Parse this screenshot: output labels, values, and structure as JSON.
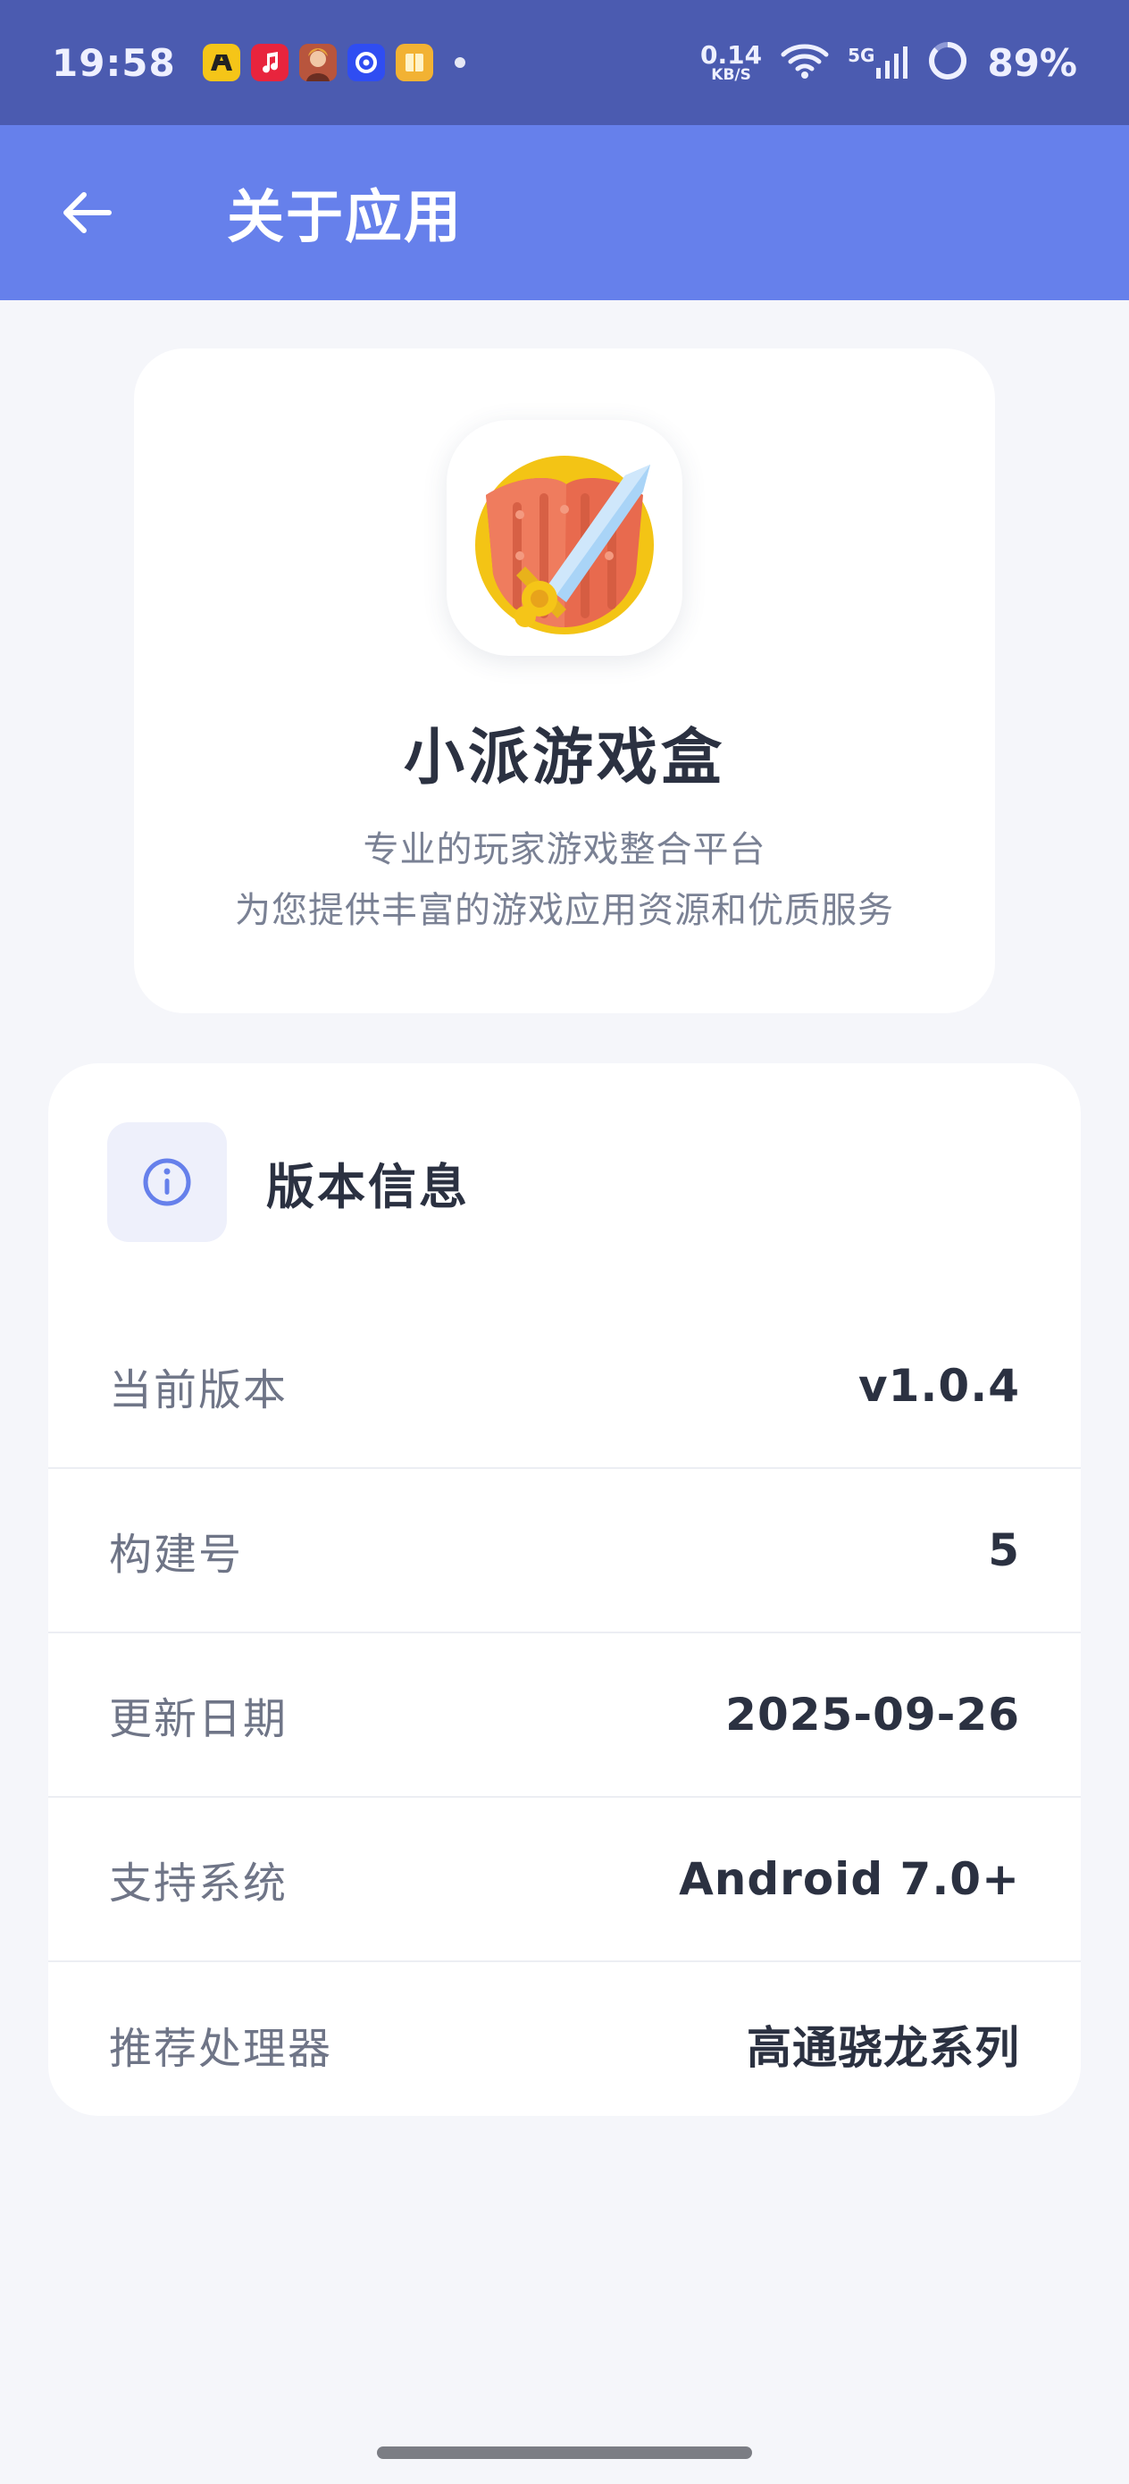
{
  "status_bar": {
    "time": "19:58",
    "notifications": [
      {
        "icon": "app-notification-icon-yellow",
        "color": "#f5c518"
      },
      {
        "icon": "music-notification-icon",
        "color": "#e8243d"
      },
      {
        "icon": "game-notification-icon",
        "color": "#9b4b36"
      },
      {
        "icon": "app-notification-icon-blue",
        "color": "#2f4df2"
      },
      {
        "icon": "book-notification-icon",
        "color": "#f2b233"
      }
    ],
    "net_speed_value": "0.14",
    "net_speed_unit": "KB/S",
    "network_type": "5G",
    "battery": "89%"
  },
  "app_bar": {
    "back_icon": "arrow-left-icon",
    "title": "关于应用",
    "background": "#6680eb"
  },
  "hero": {
    "app_icon": "shield-sword-icon",
    "app_name": "小派游戏盒",
    "desc_line1": "专业的玩家游戏整合平台",
    "desc_line2": "为您提供丰富的游戏应用资源和优质服务"
  },
  "version_info": {
    "section_icon": "info-icon",
    "title": "版本信息",
    "rows": [
      {
        "label": "当前版本",
        "value": "v1.0.4"
      },
      {
        "label": "构建号",
        "value": "5"
      },
      {
        "label": "更新日期",
        "value": "2025-09-26"
      },
      {
        "label": "支持系统",
        "value": "Android 7.0+"
      },
      {
        "label": "推荐处理器",
        "value": "高通骁龙系列"
      }
    ]
  },
  "colors": {
    "status_bar": "#4b5bb0",
    "accent": "#6680eb",
    "text_primary": "#2b3141",
    "text_secondary": "#7a8194"
  }
}
